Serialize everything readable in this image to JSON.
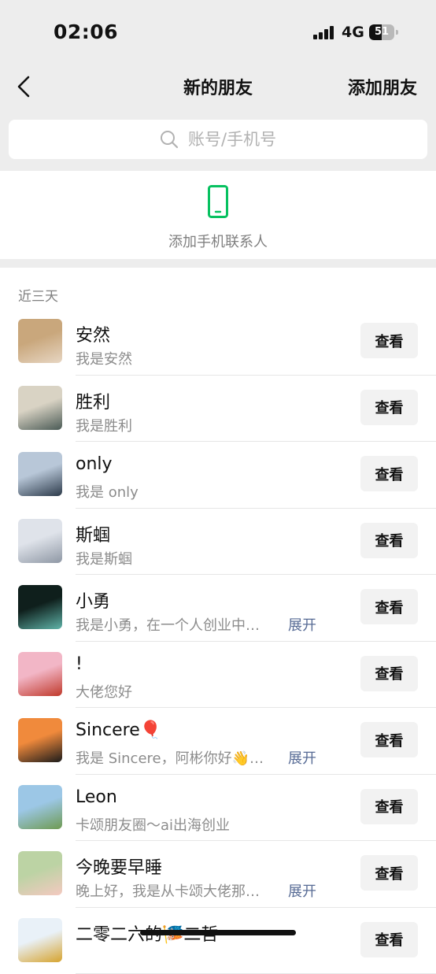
{
  "status_bar": {
    "time": "02:06",
    "network": "4G",
    "battery": "51",
    "battery_level": 0.51
  },
  "nav": {
    "title": "新的朋友",
    "action_label": "添加朋友",
    "back_icon": "chevron-left-icon"
  },
  "search": {
    "placeholder": "账号/手机号",
    "icon": "search-icon"
  },
  "add_contact": {
    "label": "添加手机联系人",
    "icon": "phone-icon",
    "icon_color": "#07c160"
  },
  "section": {
    "label": "近三天"
  },
  "requests": [
    {
      "name": "安然",
      "message": "我是安然",
      "expand": "",
      "button": "查看",
      "avatar_colors": [
        "#c9a77c",
        "#e7d6c3"
      ]
    },
    {
      "name": "胜利",
      "message": "我是胜利",
      "expand": "",
      "button": "查看",
      "avatar_colors": [
        "#d9d3c4",
        "#4a5a55"
      ]
    },
    {
      "name": "only",
      "message": "我是 only",
      "expand": "",
      "button": "查看",
      "avatar_colors": [
        "#b8c7d8",
        "#2c3a4a"
      ]
    },
    {
      "name": "斯蝈",
      "message": "我是斯蝈",
      "expand": "",
      "button": "查看",
      "avatar_colors": [
        "#dfe3ea",
        "#8e97a4"
      ]
    },
    {
      "name": "小勇",
      "message": "我是小勇，在一个人创业中…",
      "expand": "展开",
      "button": "查看",
      "avatar_colors": [
        "#0f1f1c",
        "#5fb3a8"
      ]
    },
    {
      "name": "!",
      "message": "大佬您好",
      "expand": "",
      "button": "查看",
      "avatar_colors": [
        "#f2b6c6",
        "#c0392b"
      ]
    },
    {
      "name": "Sincere🎈",
      "message": "我是 Sincere，阿彬你好👋…",
      "expand": "展开",
      "button": "查看",
      "avatar_colors": [
        "#f08a3c",
        "#1b1b1b"
      ]
    },
    {
      "name": "Leon",
      "message": "卡颂朋友圈～ai出海创业",
      "expand": "",
      "button": "查看",
      "avatar_colors": [
        "#9cc7e6",
        "#6e9a52"
      ]
    },
    {
      "name": "今晚要早睡",
      "message": "晚上好，我是从卡颂大佬那…",
      "expand": "展开",
      "button": "查看",
      "avatar_colors": [
        "#bcd3a4",
        "#f4c9c0"
      ]
    },
    {
      "name": "二零二六的🎏二哲",
      "message": "",
      "expand": "",
      "button": "查看",
      "avatar_colors": [
        "#e9f1f8",
        "#d6a32e"
      ]
    }
  ]
}
